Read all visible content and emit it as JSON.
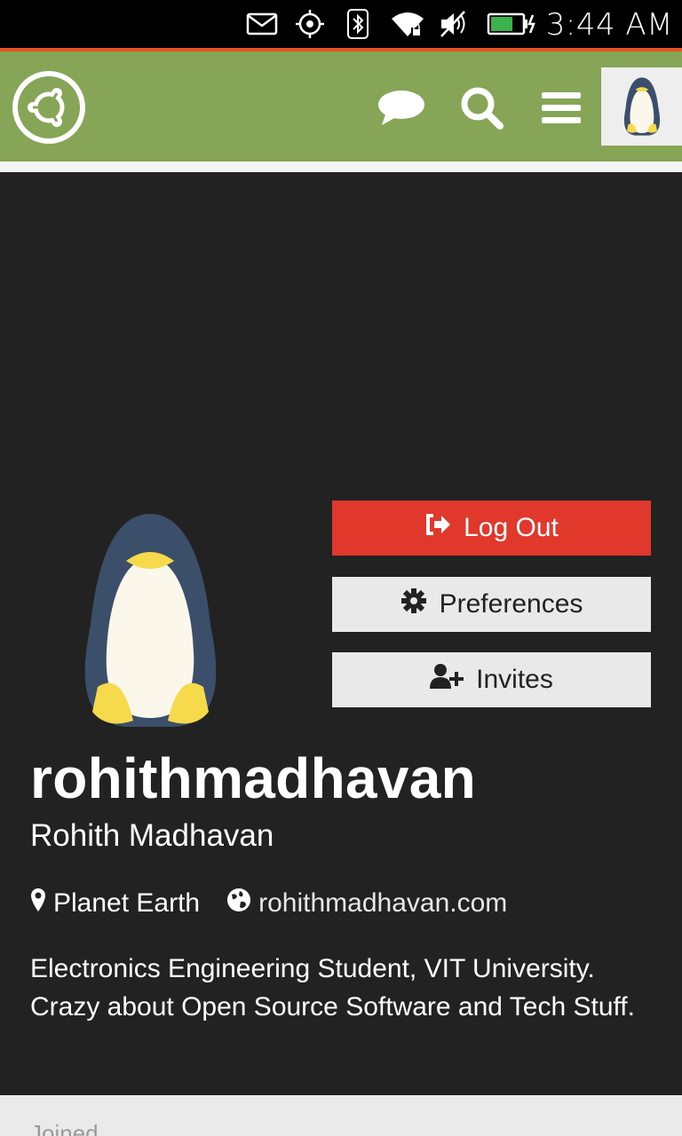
{
  "status_bar": {
    "time": "3:44 AM",
    "icons": [
      "mail-icon",
      "location-target-icon",
      "bluetooth-icon",
      "wifi-locked-icon",
      "muted-volume-icon",
      "battery-charging-icon"
    ]
  },
  "app_bar": {
    "logo": "ubuntu-logo-icon",
    "actions": [
      "chat-icon",
      "search-icon",
      "menu-icon"
    ],
    "avatar": "penguin-avatar"
  },
  "profile": {
    "buttons": {
      "logout": "Log Out",
      "preferences": "Preferences",
      "invites": "Invites"
    },
    "username": "rohithmadhavan",
    "full_name": "Rohith Madhavan",
    "location": "Planet Earth",
    "website": "rohithmadhavan.com",
    "bio": "Electronics Engineering Student, VIT University. Crazy about Open Source Software and Tech Stuff.",
    "joined_label": "Joined"
  },
  "colors": {
    "app_bar": "#87a556",
    "logout": "#e0392b",
    "profile_bg": "#222222",
    "status_accent": "#e95420"
  }
}
